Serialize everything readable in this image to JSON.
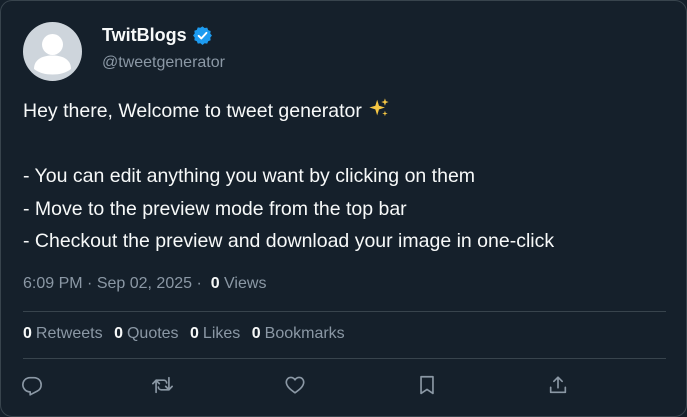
{
  "author": {
    "display_name": "TwitBlogs",
    "handle": "@tweetgenerator",
    "verified": true,
    "verified_icon": "verified-badge-icon",
    "avatar_icon": "default-avatar-icon"
  },
  "tweet": {
    "lines": [
      "Hey there, Welcome to tweet generator",
      "",
      "- You can edit anything you want by clicking on them",
      "- Move to the preview mode from the top bar",
      "- Checkout the preview and download your image in one-click"
    ],
    "emoji": "sparkles-icon",
    "time": "6:09 PM",
    "date": "Sep 02, 2025",
    "views_count": "0",
    "views_label": "Views"
  },
  "stats": [
    {
      "count": "0",
      "label": "Retweets"
    },
    {
      "count": "0",
      "label": "Quotes"
    },
    {
      "count": "0",
      "label": "Likes"
    },
    {
      "count": "0",
      "label": "Bookmarks"
    }
  ],
  "actions": [
    "reply-icon",
    "retweet-icon",
    "like-icon",
    "bookmark-icon",
    "share-icon"
  ],
  "colors": {
    "background": "#15202b",
    "border": "#38444d",
    "text_primary": "#f7f9f9",
    "text_secondary": "#8b98a5",
    "verified_blue": "#1d9bf0",
    "avatar_bg": "#ced5dc"
  }
}
